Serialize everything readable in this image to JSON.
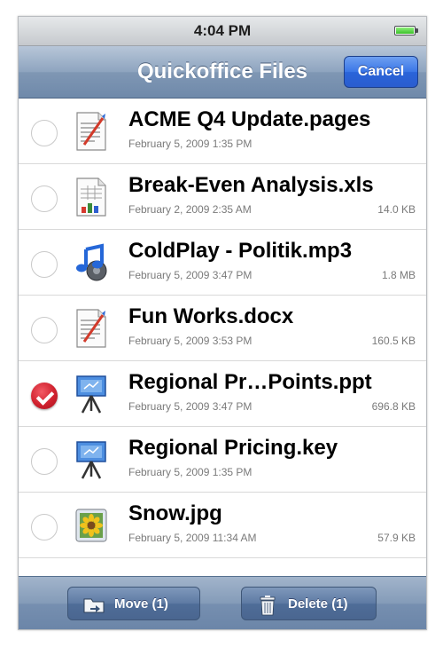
{
  "status_bar": {
    "time": "4:04 PM"
  },
  "nav": {
    "title": "Quickoffice Files",
    "cancel_label": "Cancel"
  },
  "files": [
    {
      "name": "ACME Q4 Update.pages",
      "date": "February 5, 2009 1:35 PM",
      "size": "",
      "icon": "document-icon",
      "selected": false
    },
    {
      "name": "Break-Even Analysis.xls",
      "date": "February 2, 2009 2:35 AM",
      "size": "14.0 KB",
      "icon": "spreadsheet-icon",
      "selected": false
    },
    {
      "name": "ColdPlay - Politik.mp3",
      "date": "February 5, 2009 3:47 PM",
      "size": "1.8 MB",
      "icon": "music-icon",
      "selected": false
    },
    {
      "name": "Fun Works.docx",
      "date": "February 5, 2009 3:53 PM",
      "size": "160.5 KB",
      "icon": "document-icon",
      "selected": false
    },
    {
      "name": "Regional Pr…Points.ppt",
      "date": "February 5, 2009 3:47 PM",
      "size": "696.8 KB",
      "icon": "presentation-icon",
      "selected": true
    },
    {
      "name": "Regional Pricing.key",
      "date": "February 5, 2009 1:35 PM",
      "size": "",
      "icon": "presentation-icon",
      "selected": false
    },
    {
      "name": "Snow.jpg",
      "date": "February 5, 2009 11:34 AM",
      "size": "57.9 KB",
      "icon": "image-icon",
      "selected": false
    }
  ],
  "toolbar": {
    "move_label": "Move (1)",
    "delete_label": "Delete (1)"
  },
  "colors": {
    "nav_bar": "#8ea4bf",
    "cancel_button": "#3a76e6",
    "checked": "#d0212e"
  }
}
